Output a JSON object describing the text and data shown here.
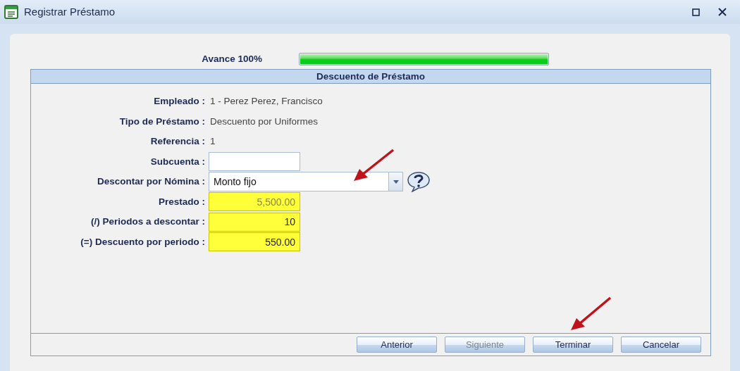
{
  "window": {
    "title": "Registrar Préstamo"
  },
  "progress": {
    "label": "Avance 100%",
    "level": 1.0
  },
  "section": {
    "title": "Descuento de Préstamo",
    "fields": [
      {
        "kind": "text",
        "label": "Empleado :",
        "value": "1 - Perez Perez, Francisco"
      },
      {
        "kind": "text",
        "label": "Tipo de Préstamo :",
        "value": "Descuento por Uniformes"
      },
      {
        "kind": "text",
        "label": "Referencia :",
        "value": "1"
      },
      {
        "kind": "input",
        "label": "Subcuenta :"
      },
      {
        "kind": "select",
        "label": "Descontar por Nómina :",
        "value": "Monto fijo"
      },
      {
        "kind": "number",
        "label": "Prestado :",
        "value": "5,500.00",
        "disabled": true
      },
      {
        "kind": "number",
        "label": "(/) Periodos a descontar :",
        "value": "10",
        "disabled": false
      },
      {
        "kind": "number",
        "label": "(=) Descuento por periodo :",
        "value": "550.00",
        "disabled": false
      }
    ]
  },
  "buttons": [
    {
      "label": "Anterior",
      "disabled": false
    },
    {
      "label": "Siguiente",
      "disabled": true
    },
    {
      "label": "Terminar",
      "disabled": false
    },
    {
      "label": "Cancelar",
      "disabled": false
    }
  ]
}
